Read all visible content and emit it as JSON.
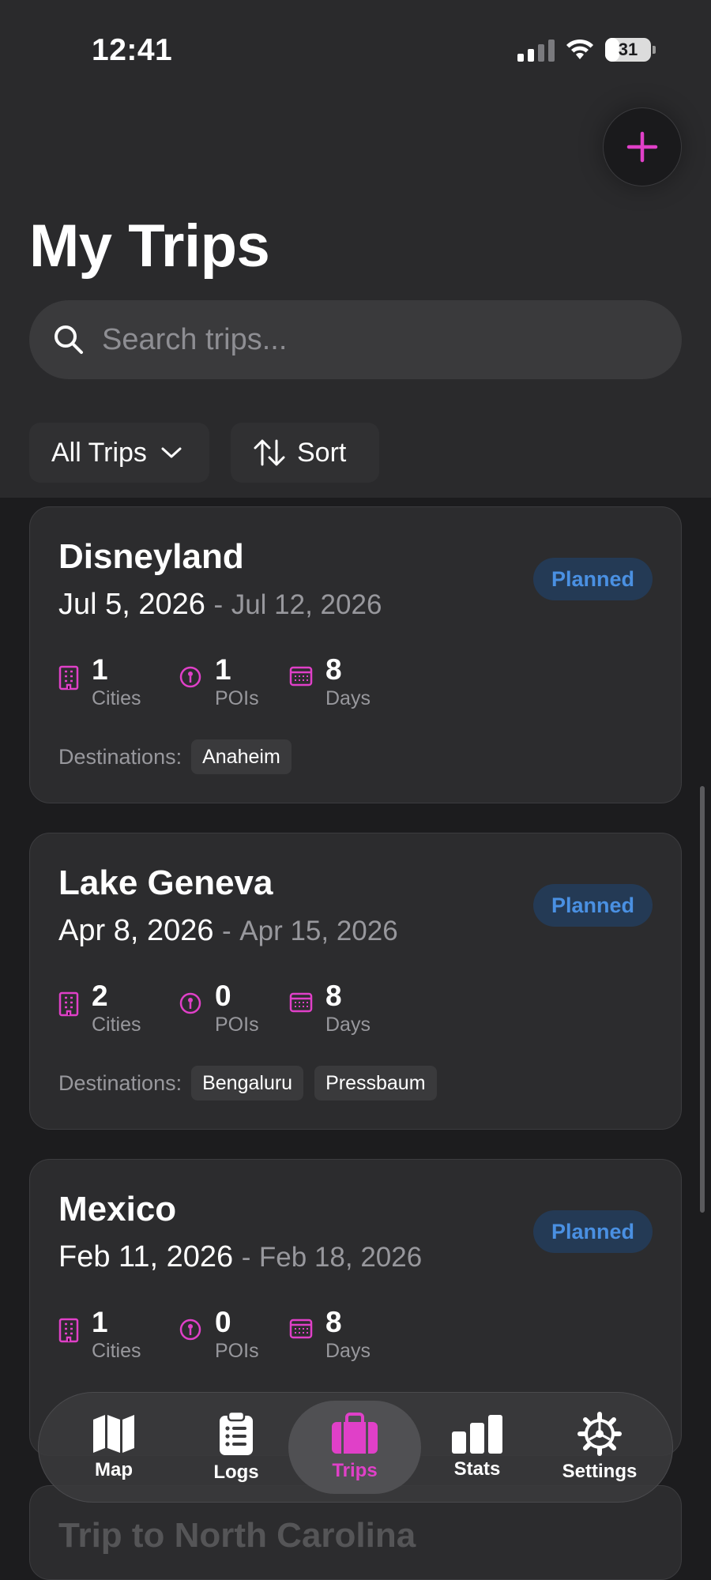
{
  "status_bar": {
    "time": "12:41",
    "battery": "31"
  },
  "header": {
    "title": "My Trips",
    "add_icon": "plus-icon"
  },
  "search": {
    "placeholder": "Search trips...",
    "value": ""
  },
  "filters": {
    "all_label": "All Trips",
    "sort_label": "Sort"
  },
  "trips": [
    {
      "name": "Disneyland",
      "start": "Jul 5, 2026",
      "sep": "-",
      "end": "Jul 12, 2026",
      "status": "Planned",
      "cities": "1",
      "cities_label": "Cities",
      "pois": "1",
      "pois_label": "POIs",
      "days": "8",
      "days_label": "Days",
      "dest_label": "Destinations:",
      "destinations": [
        "Anaheim"
      ]
    },
    {
      "name": "Lake Geneva",
      "start": "Apr 8, 2026",
      "sep": "-",
      "end": "Apr 15, 2026",
      "status": "Planned",
      "cities": "2",
      "cities_label": "Cities",
      "pois": "0",
      "pois_label": "POIs",
      "days": "8",
      "days_label": "Days",
      "dest_label": "Destinations:",
      "destinations": [
        "Bengaluru",
        "Pressbaum"
      ]
    },
    {
      "name": "Mexico",
      "start": "Feb 11, 2026",
      "sep": "-",
      "end": "Feb 18, 2026",
      "status": "Planned",
      "cities": "1",
      "cities_label": "Cities",
      "pois": "0",
      "pois_label": "POIs",
      "days": "8",
      "days_label": "Days"
    },
    {
      "name": "Trip to North Carolina"
    }
  ],
  "tabs": [
    {
      "label": "Map",
      "icon": "map-icon"
    },
    {
      "label": "Logs",
      "icon": "clipboard-icon"
    },
    {
      "label": "Trips",
      "icon": "suitcase-icon",
      "active": true
    },
    {
      "label": "Stats",
      "icon": "bar-chart-icon"
    },
    {
      "label": "Settings",
      "icon": "gear-icon"
    }
  ],
  "colors": {
    "accent": "#e040c8",
    "badge_text": "#4a90e2",
    "badge_bg": "#243a55",
    "background": "#1c1c1e"
  }
}
